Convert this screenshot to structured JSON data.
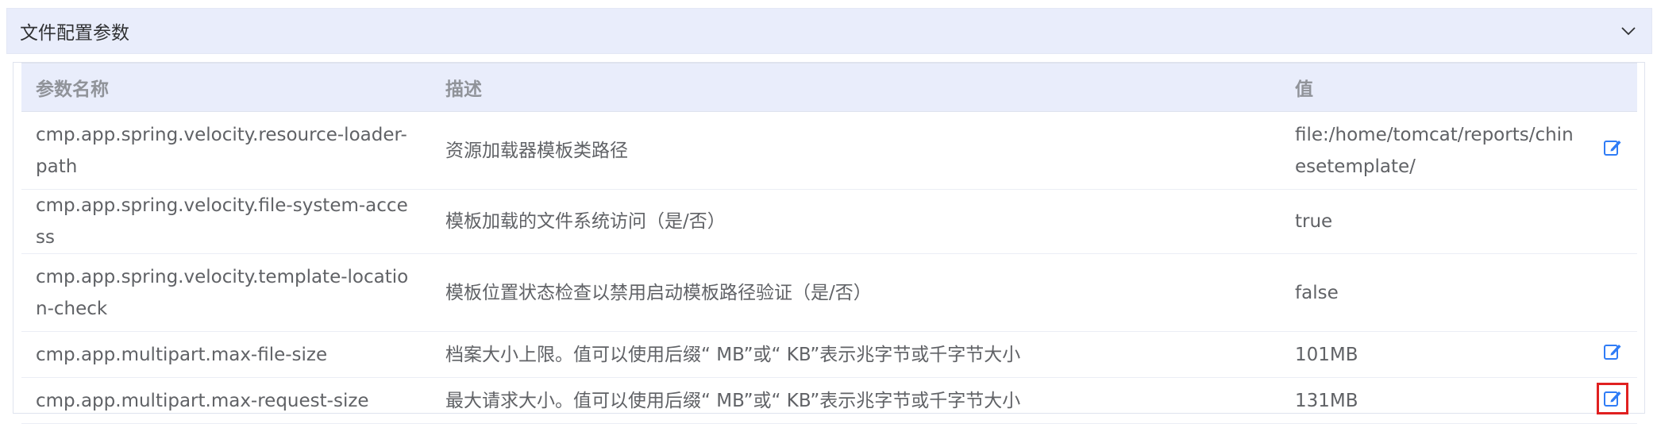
{
  "panel": {
    "title": "文件配置参数",
    "collapse_icon": "chevron-down-icon"
  },
  "table": {
    "columns": [
      "参数名称",
      "描述",
      "值"
    ],
    "rows": [
      {
        "name": "cmp.app.spring.velocity.resource-loader-path",
        "description": "资源加载器模板类路径",
        "value": "file:/home/tomcat/reports/chinesetemplate/",
        "editable": true
      },
      {
        "name": "cmp.app.spring.velocity.file-system-access",
        "description": "模板加载的文件系统访问（是/否）",
        "value": "true",
        "editable": false
      },
      {
        "name": "cmp.app.spring.velocity.template-location-check",
        "description": "模板位置状态检查以禁用启动模板路径验证（是/否）",
        "value": "false",
        "editable": false
      },
      {
        "name": "cmp.app.multipart.max-file-size",
        "description": "档案大小上限。值可以使用后缀“ MB”或“ KB”表示兆字节或千字节大小",
        "value": "101MB",
        "editable": true
      },
      {
        "name": "cmp.app.multipart.max-request-size",
        "description": "最大请求大小。值可以使用后缀“ MB”或“ KB”表示兆字节或千字节大小",
        "value": "131MB",
        "editable": true
      }
    ]
  },
  "colors": {
    "header_bg": "#e9edfb",
    "edit_icon": "#2f7cf6",
    "highlight_border": "#e02020"
  }
}
